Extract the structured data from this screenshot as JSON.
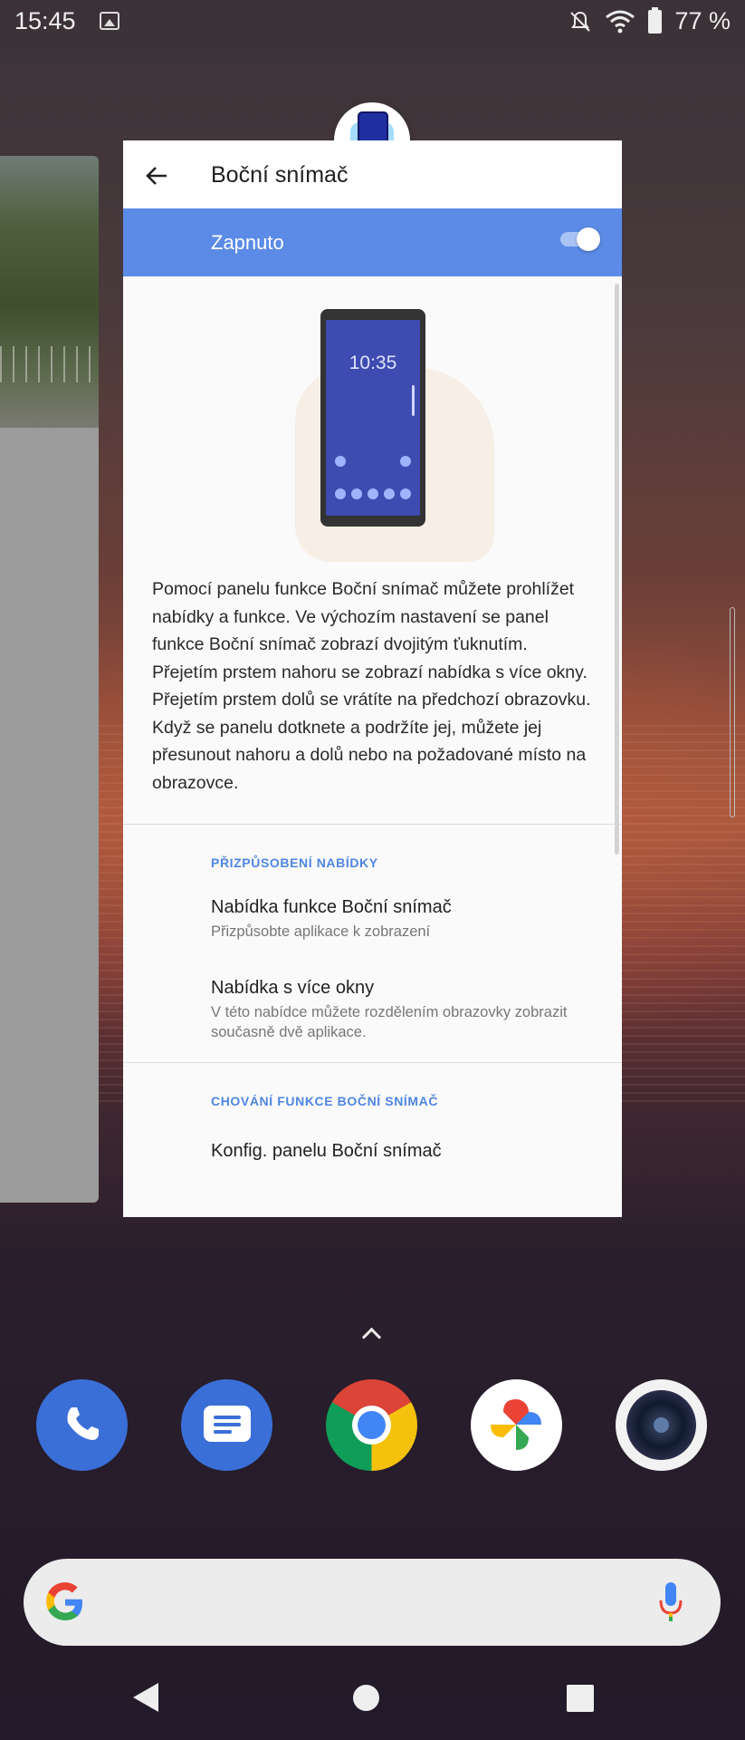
{
  "status_bar": {
    "time": "15:45",
    "battery": "77 %"
  },
  "settings": {
    "title": "Boční snímač",
    "toggle_label": "Zapnuto",
    "toggle_on": true,
    "illustration_clock": "10:35",
    "description": "Pomocí panelu funkce Boční snímač můžete prohlížet nabídky a funkce. Ve výchozím nastavení se panel funkce Boční snímač zobrazí dvojitým ťuknutím. Přejetím prstem nahoru se zobrazí nabídka s více okny. Přejetím prstem dolů se vrátíte na předchozí obrazovku.\nKdyž se panelu dotknete a podržíte jej, můžete jej přesunout nahoru a dolů nebo na požadované místo na obrazovce.",
    "section1_header": "PŘIZPŮSOBENÍ NABÍDKY",
    "items": [
      {
        "title": "Nabídka funkce Boční snímač",
        "subtitle": "Přizpůsobte aplikace k zobrazení"
      },
      {
        "title": "Nabídka s více okny",
        "subtitle": "V této nabídce můžete rozdělením obrazovky zobrazit současně dvě aplikace."
      }
    ],
    "section2_header": "CHOVÁNÍ FUNKCE BOČNÍ SNÍMAČ",
    "item3_title": "Konfig. panelu Boční snímač",
    "accent_color": "#5b8be6"
  },
  "dock": {
    "apps": [
      "phone-icon",
      "messages-icon",
      "chrome-icon",
      "photos-icon",
      "camera-icon"
    ]
  }
}
